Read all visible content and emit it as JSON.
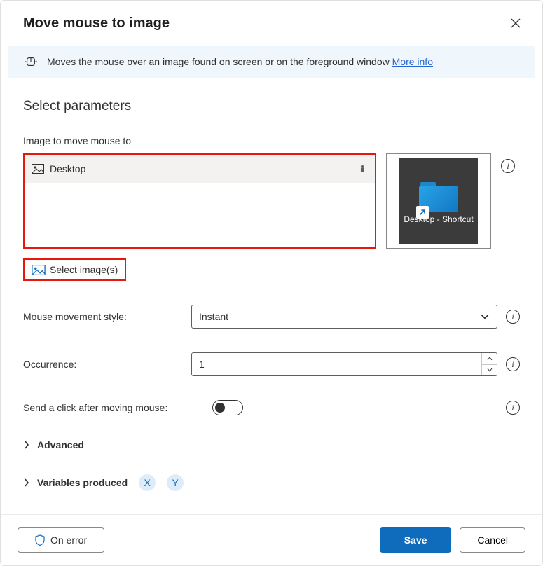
{
  "header": {
    "title": "Move mouse to image"
  },
  "infoBar": {
    "text": "Moves the mouse over an image found on screen or on the foreground window ",
    "linkText": "More info"
  },
  "section": {
    "title": "Select parameters"
  },
  "imageField": {
    "label": "Image to move mouse to",
    "items": [
      {
        "name": "Desktop"
      }
    ],
    "previewCaption": "Desktop - Shortcut",
    "selectButton": "Select image(s)"
  },
  "mouseStyle": {
    "label": "Mouse movement style:",
    "value": "Instant"
  },
  "occurrence": {
    "label": "Occurrence:",
    "value": "1"
  },
  "sendClick": {
    "label": "Send a click after moving mouse:",
    "value": false
  },
  "advanced": {
    "label": "Advanced"
  },
  "variables": {
    "label": "Variables produced",
    "pills": [
      "X",
      "Y"
    ]
  },
  "footer": {
    "onError": "On error",
    "save": "Save",
    "cancel": "Cancel"
  }
}
